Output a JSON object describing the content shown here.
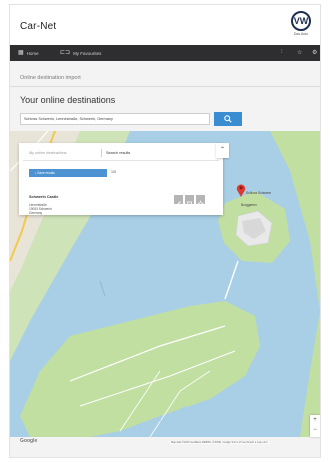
{
  "app": {
    "title": "Car-Net",
    "logo_tagline": "Das Auto"
  },
  "nav": {
    "items": [
      {
        "label": "Home",
        "icon": "grid-icon"
      },
      {
        "label": "My Favourites",
        "icon": "car-icon"
      }
    ],
    "right_icons": [
      "user-icon",
      "star-icon",
      "gear-icon"
    ]
  },
  "page": {
    "section_label": "Online destination import",
    "heading": "Your online destinations"
  },
  "search": {
    "value": "Schloss Schwerin, Lennéstraße, Schwerin, Germany"
  },
  "panel": {
    "tabs": [
      {
        "label": "My online destinations",
        "active": false
      },
      {
        "label": "Search results",
        "active": true
      }
    ],
    "save_label": "Save results",
    "count": "1/5",
    "result": {
      "title": "Schwerin Castle",
      "address_lines": [
        "Lennéstraße",
        "19053 Schwerin",
        "Germany"
      ]
    }
  },
  "map": {
    "marker_label": "Schloss Schwerin",
    "garden_label": "Burggarten",
    "attribution": "Map data ©2015 GeoBasis-DE/BKG (©2009), Google   Terms of Use   Report a map error",
    "provider": "Google",
    "zoom_in": "+",
    "zoom_out": "−"
  },
  "colors": {
    "nav_bg": "#2e2e30",
    "accent": "#3a8dd0",
    "water": "#a8cfe6",
    "land": "#c2dfa2",
    "marker": "#d83c33"
  }
}
